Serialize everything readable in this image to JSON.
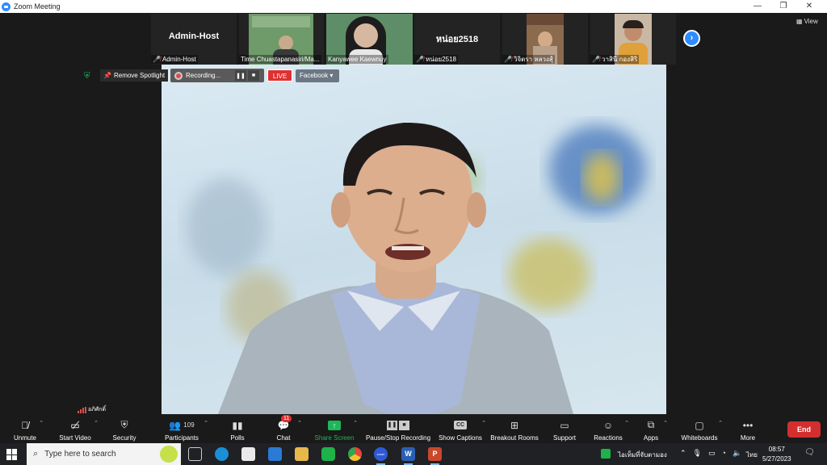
{
  "window": {
    "title": "Zoom Meeting",
    "controls": [
      "—",
      "❐",
      "✕"
    ]
  },
  "gallery": {
    "tiles": [
      {
        "name": "Admin-Host",
        "display_text": "Admin-Host",
        "muted": true
      },
      {
        "name": "Time Chuastapanasiri/Ma...",
        "muted": false
      },
      {
        "name": "Kanyawee Kaewnuy",
        "muted": false
      },
      {
        "name": "หน่อย2518",
        "display_text": "หน่อย2518",
        "muted": true
      },
      {
        "name": "วิจิตรา หลวงสุ้",
        "muted": true
      },
      {
        "name": "วาสินี กองสิริ",
        "muted": true
      }
    ],
    "next_icon": "›",
    "view_label": "View"
  },
  "spotlight": {
    "remove_label": "Remove Spotlight",
    "recording_label": "Recording...",
    "pause_icon": "❚❚",
    "stop_icon": "■",
    "live_label": "LIVE",
    "facebook_label": "Facebook ▾"
  },
  "speaker": {
    "name": "อภิศักดิ์"
  },
  "toolbar": {
    "unmute": "Unmute",
    "start_video": "Start Video",
    "security": "Security",
    "participants": "Participants",
    "participants_count": "109",
    "polls": "Polls",
    "chat": "Chat",
    "chat_badge": "11",
    "share_screen": "Share Screen",
    "pause_stop_recording": "Pause/Stop Recording",
    "show_captions": "Show Captions",
    "breakout_rooms": "Breakout Rooms",
    "support": "Support",
    "reactions": "Reactions",
    "apps": "Apps",
    "whiteboards": "Whiteboards",
    "more": "More",
    "end": "End",
    "cc_icon": "CC"
  },
  "taskbar": {
    "search_placeholder": "Type here to search",
    "tray_text": "ไอเท็มที่จับตามอง",
    "lang": "ไทย",
    "time": "08:57",
    "date": "5/27/2023",
    "word_label": "W",
    "ppt_label": "P",
    "zoom_label": "zoom"
  },
  "colors": {
    "zoom_blue": "#2d8cff",
    "end_red": "#d32f2f",
    "live_red": "#e03030",
    "share_green": "#1cb85a"
  }
}
